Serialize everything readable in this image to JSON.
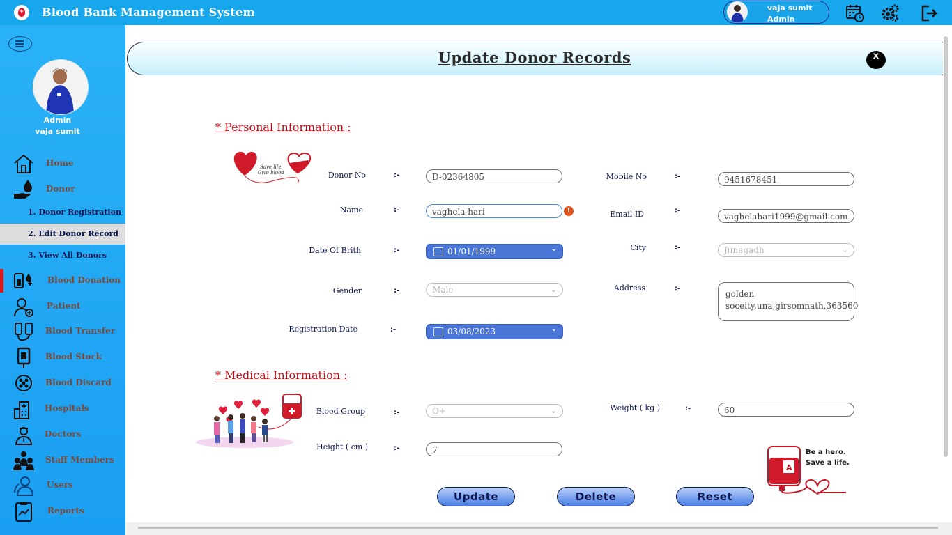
{
  "app": {
    "title": "Blood Bank Management System"
  },
  "user": {
    "name": "vaja sumit",
    "role": "Admin"
  },
  "sidebar": {
    "role": "Admin",
    "name": "vaja sumit",
    "items": [
      {
        "label": "Home",
        "icon": "home-icon"
      },
      {
        "label": "Donor",
        "icon": "donor-icon"
      },
      {
        "label": "Blood Donation",
        "icon": "blood-donation-icon"
      },
      {
        "label": "Patient",
        "icon": "patient-icon"
      },
      {
        "label": "Blood Transfer",
        "icon": "blood-transfer-icon"
      },
      {
        "label": "Blood Stock",
        "icon": "blood-stock-icon"
      },
      {
        "label": "Blood Discard",
        "icon": "blood-discard-icon"
      },
      {
        "label": "Hospitals",
        "icon": "hospital-icon"
      },
      {
        "label": "Doctors",
        "icon": "doctor-icon"
      },
      {
        "label": "Staff Members",
        "icon": "staff-icon"
      },
      {
        "label": "Users",
        "icon": "users-icon"
      },
      {
        "label": "Reports",
        "icon": "reports-icon"
      }
    ],
    "donor_sub": [
      {
        "label": "1.  Donor Registration"
      },
      {
        "label": "2.  Edit Donor Record"
      },
      {
        "label": "3.  View All Donors"
      }
    ]
  },
  "page": {
    "title": "Update Donor Records",
    "close_label": "x"
  },
  "personal": {
    "section_title": "*  Personal Information  :",
    "image_text": [
      "Save life",
      "Give blood"
    ],
    "separator": ":-",
    "fields": {
      "donor_no": {
        "label": "Donor No",
        "value": "D-02364805"
      },
      "name": {
        "label": "Name",
        "value": "vaghela hari"
      },
      "dob": {
        "label": "Date Of Brith",
        "value": "01/01/1999"
      },
      "gender": {
        "label": "Gender",
        "value": "Male"
      },
      "reg_date": {
        "label": "Registration Date",
        "value": "03/08/2023"
      },
      "mobile": {
        "label": "Mobile No",
        "value": "9451678451"
      },
      "email": {
        "label": "Email ID",
        "value": "vaghelahari1999@gmail.com"
      },
      "city": {
        "label": "City",
        "value": "Junagadh"
      },
      "address": {
        "label": "Address",
        "value_line1": "golden",
        "value_line2": "soceity,una,girsomnath,363560"
      }
    }
  },
  "medical": {
    "section_title": "*  Medical Information  :",
    "fields": {
      "blood_group": {
        "label": "Blood Group",
        "value": "O+"
      },
      "height": {
        "label": "Height ( cm )",
        "value": "7"
      },
      "weight": {
        "label": "Weight ( kg )",
        "value": "60"
      }
    },
    "hero_text": [
      "Be a hero.",
      "Save a life."
    ],
    "bag_label": "A"
  },
  "buttons": {
    "update": "Update",
    "delete": "Delete",
    "reset": "Reset"
  },
  "colors": {
    "topbar": "#17a7ec",
    "sidebar": "#1fa6f4",
    "section_title": "#c0101a",
    "label": "#0b1650",
    "accent_red": "#e01a1a"
  }
}
